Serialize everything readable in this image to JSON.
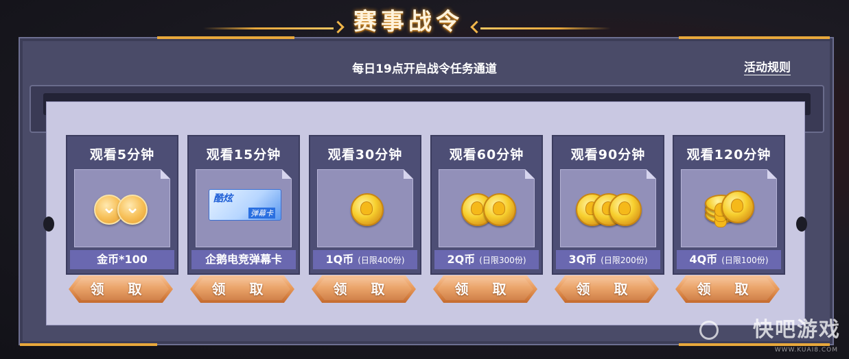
{
  "header": {
    "title": "赛事战令"
  },
  "subtitle": "每日19点开启战令任务通道",
  "rules_link": "活动规则",
  "claim_label": "领 取",
  "cards": [
    {
      "title": "观看5分钟",
      "reward": "金币*100",
      "limit": "",
      "icon": "gold-coins-icon"
    },
    {
      "title": "观看15分钟",
      "reward": "企鹅电竞弹幕卡",
      "limit": "",
      "icon": "danmaku-card-icon",
      "card_text_top": "酷炫",
      "card_text_bottom": "弹幕卡"
    },
    {
      "title": "观看30分钟",
      "reward": "1Q币",
      "limit": "(日限400份)",
      "icon": "q-coin-icon"
    },
    {
      "title": "观看60分钟",
      "reward": "2Q币",
      "limit": "(日限300份)",
      "icon": "q-coin-icon"
    },
    {
      "title": "观看90分钟",
      "reward": "3Q币",
      "limit": "(日限200份)",
      "icon": "q-coin-icon"
    },
    {
      "title": "观看120分钟",
      "reward": "4Q币",
      "limit": "(日限100份)",
      "icon": "q-coin-stack-icon"
    }
  ],
  "watermark": {
    "text": "快吧游戏",
    "url_text": "WWW.KUAI8.COM"
  }
}
